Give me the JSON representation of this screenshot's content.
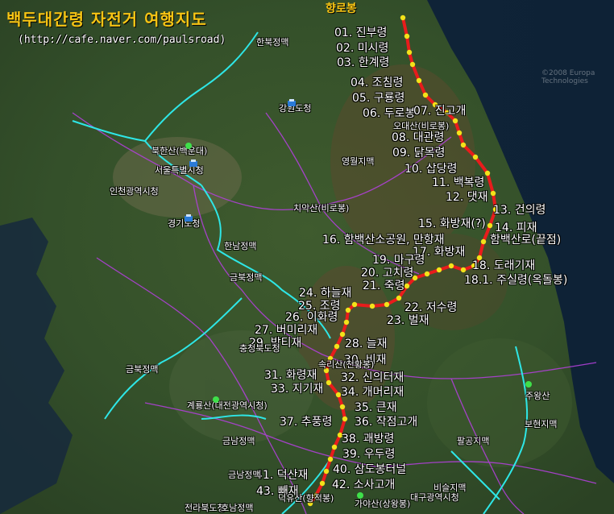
{
  "map": {
    "title": "백두대간령 자전거 여행지도",
    "url": "(http://cafe.naver.com/paulsroad)",
    "start_label": "향로봉",
    "watermark": "©2008 Europa Technologies",
    "colors": {
      "route": "#e81c1c",
      "waypoint": "#f2e21a",
      "roads": "#b040d8",
      "borders": "#2ee6e6",
      "title": "#f7c414"
    }
  },
  "waypoints": [
    "01. 진부령",
    "02. 미시령",
    "03. 한계령",
    "04. 조침령",
    "05. 구룡령",
    "06. 두로봉",
    "07. 진고개",
    "08. 대관령",
    "09. 닭목령",
    "10. 삽당령",
    "11. 백복령",
    "12. 댓재",
    "13. 건의령",
    "14. 피재",
    "15. 화방재(?)",
    "16. 함백산소공원, 만항재",
    "함백산로(끝점)",
    "17. 화방재",
    "18. 도래기재",
    "18.1. 주실령(옥돌봉)",
    "19. 마구령",
    "20. 고치령",
    "21. 죽령",
    "22. 저수령",
    "23. 벌재",
    "24. 하늘재",
    "25. 조령",
    "26. 이화령",
    "27. 버미리재",
    "28. 늘재",
    "29. 밤티재",
    "30. 비재",
    "31. 화령재",
    "32. 신의터재",
    "33. 지기재",
    "34. 개머리재",
    "35. 큰재",
    "36. 작점고개",
    "37. 추풍령",
    "38. 괘방령",
    "39. 우두령",
    "40. 삼도봉터널",
    "41. 덕산재",
    "42. 소사고개",
    "43. 빼재"
  ],
  "places": [
    "한북정맥",
    "강원도청",
    "오대산(비로봉)",
    "영월지맥",
    "북한산(백운대)",
    "서울특별시청",
    "인천광역시청",
    "경기도청",
    "치악산(비로봉)",
    "한남정맥",
    "금북정맥",
    "충청북도청",
    "속리산(천황봉)",
    "금북정맥",
    "계룡산(대전광역시청)",
    "금남정맥",
    "금남정맥",
    "주왕산",
    "보현지맥",
    "팔공지맥",
    "비슬지맥",
    "대구광역시청",
    "가야산(상왕봉)",
    "덕유산(향적봉)",
    "전라북도청",
    "호남정맥"
  ]
}
